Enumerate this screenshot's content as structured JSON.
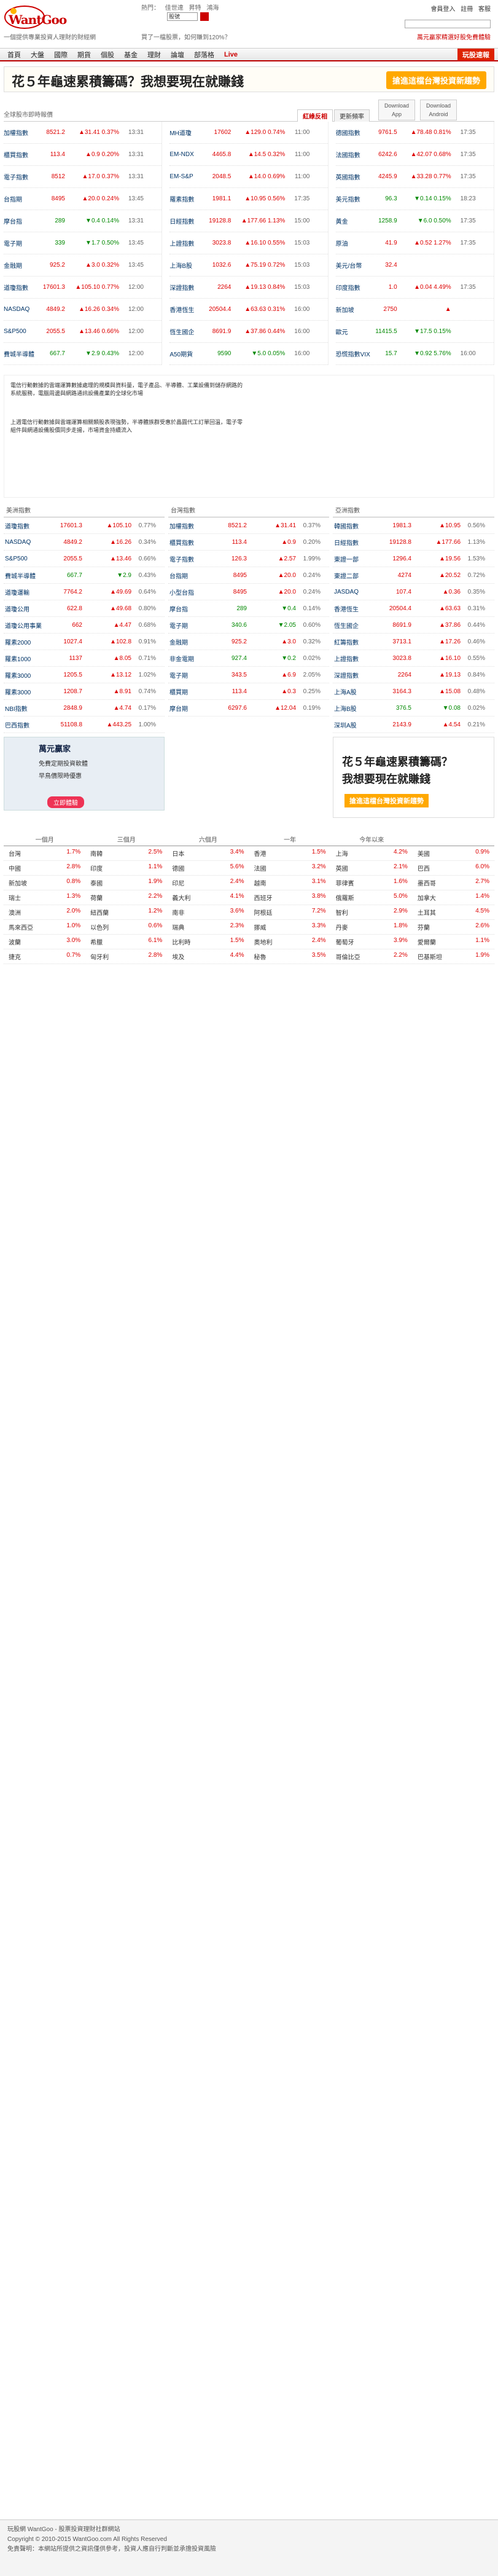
{
  "header": {
    "logo": "WantGoo",
    "hot_label": "熱門：",
    "hot_items": [
      "佳世達",
      "昇特",
      "鴻海"
    ],
    "search_placeholder": "股號",
    "top_links": [
      "會員登入",
      "註冊",
      "客服"
    ],
    "sub_left": "一個提供專業投資人理財的財經網",
    "sub_mid": "買了一檔股票，如何賺到120%？",
    "sub_right": "萬元贏家精選好股免費體驗"
  },
  "nav": {
    "items": [
      "首頁",
      "大盤",
      "國際",
      "期貨",
      "個股",
      "基金",
      "理財",
      "論壇",
      "部落格",
      "Live"
    ],
    "cta": "玩股速報"
  },
  "banner": {
    "text": "花５年龜速累積籌碼？我想要現在就賺錢",
    "button": "搶進這檔台灣投資新趨勢"
  },
  "quote_tabs": {
    "label": "全球股市即時報價",
    "tabs": [
      "紅綠反相",
      "更新頻率"
    ],
    "app_ios": "Download App",
    "app_android": "Download Android"
  },
  "quotes": [
    [
      {
        "name": "加權指數",
        "price": "8521.2",
        "chg": "▲31.41",
        "pct": "0.37%",
        "time": "13:31",
        "dir": "up"
      },
      {
        "name": "櫃買指數",
        "price": "113.4",
        "chg": "▲0.9",
        "pct": "0.20%",
        "time": "13:31",
        "dir": "up"
      },
      {
        "name": "電子指數",
        "price": "8512",
        "chg": "▲17.0",
        "pct": "0.37%",
        "time": "13:31",
        "dir": "up"
      },
      {
        "name": "台指期",
        "price": "8495",
        "chg": "▲20.0",
        "pct": "0.24%",
        "time": "13:45",
        "dir": "up"
      },
      {
        "name": "摩台指",
        "price": "289",
        "chg": "▼0.4",
        "pct": "0.14%",
        "time": "13:31",
        "dir": "down"
      },
      {
        "name": "電子期",
        "price": "339",
        "chg": "▼1.7",
        "pct": "0.50%",
        "time": "13:45",
        "dir": "down"
      },
      {
        "name": "金融期",
        "price": "925.2",
        "chg": "▲3.0",
        "pct": "0.32%",
        "time": "13:45",
        "dir": "up"
      },
      {
        "name": "道瓊指數",
        "price": "17601.3",
        "chg": "▲105.10",
        "pct": "0.77%",
        "time": "12:00",
        "dir": "up"
      },
      {
        "name": "NASDAQ",
        "price": "4849.2",
        "chg": "▲16.26",
        "pct": "0.34%",
        "time": "12:00",
        "dir": "up"
      },
      {
        "name": "S&P500",
        "price": "2055.5",
        "chg": "▲13.46",
        "pct": "0.66%",
        "time": "12:00",
        "dir": "up"
      },
      {
        "name": "費城半導體",
        "price": "667.7",
        "chg": "▼2.9",
        "pct": "0.43%",
        "time": "12:00",
        "dir": "down"
      }
    ],
    [
      {
        "name": "MH道瓊",
        "price": "17602",
        "chg": "▲129.0",
        "pct": "0.74%",
        "time": "11:00",
        "dir": "up"
      },
      {
        "name": "EM-NDX",
        "price": "4465.8",
        "chg": "▲14.5",
        "pct": "0.32%",
        "time": "11:00",
        "dir": "up"
      },
      {
        "name": "EM-S&P",
        "price": "2048.5",
        "chg": "▲14.0",
        "pct": "0.69%",
        "time": "11:00",
        "dir": "up"
      },
      {
        "name": "羅素指數",
        "price": "1981.1",
        "chg": "▲10.95",
        "pct": "0.56%",
        "time": "17:35",
        "dir": "up"
      },
      {
        "name": "日經指數",
        "price": "19128.8",
        "chg": "▲177.66",
        "pct": "1.13%",
        "time": "15:00",
        "dir": "up"
      },
      {
        "name": "上證指數",
        "price": "3023.8",
        "chg": "▲16.10",
        "pct": "0.55%",
        "time": "15:03",
        "dir": "up"
      },
      {
        "name": "上海B股",
        "price": "1032.6",
        "chg": "▲75.19",
        "pct": "0.72%",
        "time": "15:03",
        "dir": "up"
      },
      {
        "name": "深證指數",
        "price": "2264",
        "chg": "▲19.13",
        "pct": "0.84%",
        "time": "15:03",
        "dir": "up"
      },
      {
        "name": "香港恆生",
        "price": "20504.4",
        "chg": "▲63.63",
        "pct": "0.31%",
        "time": "16:00",
        "dir": "up"
      },
      {
        "name": "恆生國企",
        "price": "8691.9",
        "chg": "▲37.86",
        "pct": "0.44%",
        "time": "16:00",
        "dir": "up"
      },
      {
        "name": "A50期貨",
        "price": "9590",
        "chg": "▼5.0",
        "pct": "0.05%",
        "time": "16:00",
        "dir": "down"
      }
    ],
    [
      {
        "name": "德國指數",
        "price": "9761.5",
        "chg": "▲78.48",
        "pct": "0.81%",
        "time": "17:35",
        "dir": "up"
      },
      {
        "name": "法國指數",
        "price": "6242.6",
        "chg": "▲42.07",
        "pct": "0.68%",
        "time": "17:35",
        "dir": "up"
      },
      {
        "name": "英國指數",
        "price": "4245.9",
        "chg": "▲33.28",
        "pct": "0.77%",
        "time": "17:35",
        "dir": "up"
      },
      {
        "name": "美元指數",
        "price": "96.3",
        "chg": "▼0.14",
        "pct": "0.15%",
        "time": "18:23",
        "dir": "down"
      },
      {
        "name": "黃金",
        "price": "1258.9",
        "chg": "▼6.0",
        "pct": "0.50%",
        "time": "17:35",
        "dir": "down"
      },
      {
        "name": "原油",
        "price": "41.9",
        "chg": "▲0.52",
        "pct": "1.27%",
        "time": "17:35",
        "dir": "up"
      },
      {
        "name": "美元/台幣",
        "price": "32.4",
        "chg": "",
        "pct": "",
        "time": "",
        "dir": "up"
      },
      {
        "name": "印度指數",
        "price": "1.0",
        "chg": "▲0.04",
        "pct": "4.49%",
        "time": "17:35",
        "dir": "up"
      },
      {
        "name": "新加坡",
        "price": "2750",
        "chg": "▲",
        "pct": "",
        "time": "",
        "dir": "up"
      },
      {
        "name": "歐元",
        "price": "11415.5",
        "chg": "▼17.5",
        "pct": "0.15%",
        "time": "",
        "dir": "down"
      },
      {
        "name": "恐慌指數VIX",
        "price": "15.7",
        "chg": "▼0.92",
        "pct": "5.76%",
        "time": "16:00",
        "dir": "down"
      }
    ]
  ],
  "subsection": {
    "text1": "電信行動數據的雲端運算數據處理的規模與資料量，電子產品、半導體、工業設備到儲存網路的系統服務，電腦周邊與網路通訊設備產業的全球化市場",
    "text2": "上週電信行動數據與雲端運算相關類股表現強勢，半導體族群受惠於晶圓代工訂單回溫，電子零組件與網通設備股價同步走揚，市場資金持續流入"
  },
  "lower": {
    "col1_head": "美洲指數",
    "col2_head": "台灣指數",
    "col3_head": "亞洲指數",
    "col1": [
      {
        "name": "道瓊指數",
        "price": "17601.3",
        "chg": "▲105.10",
        "pct": "0.77%",
        "dir": "up"
      },
      {
        "name": "NASDAQ",
        "price": "4849.2",
        "chg": "▲16.26",
        "pct": "0.34%",
        "dir": "up"
      },
      {
        "name": "S&P500",
        "price": "2055.5",
        "chg": "▲13.46",
        "pct": "0.66%",
        "dir": "up"
      },
      {
        "name": "費城半導體",
        "price": "667.7",
        "chg": "▼2.9",
        "pct": "0.43%",
        "dir": "down"
      },
      {
        "name": "道瓊運輸",
        "price": "7764.2",
        "chg": "▲49.69",
        "pct": "0.64%",
        "dir": "up"
      },
      {
        "name": "道瓊公用",
        "price": "622.8",
        "chg": "▲49.68",
        "pct": "0.80%",
        "dir": "up"
      },
      {
        "name": "道瓊公用事業",
        "price": "662",
        "chg": "▲4.47",
        "pct": "0.68%",
        "dir": "up"
      },
      {
        "name": "羅素2000",
        "price": "1027.4",
        "chg": "▲102.8",
        "pct": "0.91%",
        "dir": "up"
      },
      {
        "name": "羅素1000",
        "price": "1137",
        "chg": "▲8.05",
        "pct": "0.71%",
        "dir": "up"
      },
      {
        "name": "羅素3000",
        "price": "1205.5",
        "chg": "▲13.12",
        "pct": "1.02%",
        "dir": "up"
      },
      {
        "name": "羅素3000",
        "price": "1208.7",
        "chg": "▲8.91",
        "pct": "0.74%",
        "dir": "up"
      },
      {
        "name": "NBI指數",
        "price": "2848.9",
        "chg": "▲4.74",
        "pct": "0.17%",
        "dir": "up"
      },
      {
        "name": "巴西指數",
        "price": "51108.8",
        "chg": "▲443.25",
        "pct": "1.00%",
        "dir": "up"
      }
    ],
    "col2": [
      {
        "name": "加權指數",
        "price": "8521.2",
        "chg": "▲31.41",
        "pct": "0.37%",
        "dir": "up"
      },
      {
        "name": "櫃買指數",
        "price": "113.4",
        "chg": "▲0.9",
        "pct": "0.20%",
        "dir": "up"
      },
      {
        "name": "電子指數",
        "price": "126.3",
        "chg": "▲2.57",
        "pct": "1.99%",
        "dir": "up"
      },
      {
        "name": "台指期",
        "price": "8495",
        "chg": "▲20.0",
        "pct": "0.24%",
        "dir": "up"
      },
      {
        "name": "小型台指",
        "price": "8495",
        "chg": "▲20.0",
        "pct": "0.24%",
        "dir": "up"
      },
      {
        "name": "摩台指",
        "price": "289",
        "chg": "▼0.4",
        "pct": "0.14%",
        "dir": "down"
      },
      {
        "name": "電子期",
        "price": "340.6",
        "chg": "▼2.05",
        "pct": "0.60%",
        "dir": "down"
      },
      {
        "name": "金融期",
        "price": "925.2",
        "chg": "▲3.0",
        "pct": "0.32%",
        "dir": "up"
      },
      {
        "name": "非金電期",
        "price": "927.4",
        "chg": "▼0.2",
        "pct": "0.02%",
        "dir": "down"
      },
      {
        "name": "電子期",
        "price": "343.5",
        "chg": "▲6.9",
        "pct": "2.05%",
        "dir": "up"
      },
      {
        "name": "櫃買期",
        "price": "113.4",
        "chg": "▲0.3",
        "pct": "0.25%",
        "dir": "up"
      },
      {
        "name": "摩台期",
        "price": "6297.6",
        "chg": "▲12.04",
        "pct": "0.19%",
        "dir": "up"
      }
    ],
    "col3": [
      {
        "name": "韓國指數",
        "price": "1981.3",
        "chg": "▲10.95",
        "pct": "0.56%",
        "dir": "up"
      },
      {
        "name": "日經指數",
        "price": "19128.8",
        "chg": "▲177.66",
        "pct": "1.13%",
        "dir": "up"
      },
      {
        "name": "東證一部",
        "price": "1296.4",
        "chg": "▲19.56",
        "pct": "1.53%",
        "dir": "up"
      },
      {
        "name": "東證二部",
        "price": "4274",
        "chg": "▲20.52",
        "pct": "0.72%",
        "dir": "up"
      },
      {
        "name": "JASDAQ",
        "price": "107.4",
        "chg": "▲0.36",
        "pct": "0.35%",
        "dir": "up"
      },
      {
        "name": "香港恆生",
        "price": "20504.4",
        "chg": "▲63.63",
        "pct": "0.31%",
        "dir": "up"
      },
      {
        "name": "恆生國企",
        "price": "8691.9",
        "chg": "▲37.86",
        "pct": "0.44%",
        "dir": "up"
      },
      {
        "name": "紅籌指數",
        "price": "3713.1",
        "chg": "▲17.26",
        "pct": "0.46%",
        "dir": "up"
      },
      {
        "name": "上證指數",
        "price": "3023.8",
        "chg": "▲16.10",
        "pct": "0.55%",
        "dir": "up"
      },
      {
        "name": "深證指數",
        "price": "2264",
        "chg": "▲19.13",
        "pct": "0.84%",
        "dir": "up"
      },
      {
        "name": "上海A股",
        "price": "3164.3",
        "chg": "▲15.08",
        "pct": "0.48%",
        "dir": "up"
      },
      {
        "name": "上海B股",
        "price": "376.5",
        "chg": "▼0.08",
        "pct": "0.02%",
        "dir": "down"
      },
      {
        "name": "深圳A股",
        "price": "2143.9",
        "chg": "▲4.54",
        "pct": "0.21%",
        "dir": "up"
      }
    ],
    "ad1": {
      "title": "萬元贏家",
      "line1": "免費定期投資軟體",
      "line2": "早鳥價限時優惠",
      "button": "立即體驗"
    },
    "ad2": {
      "line1": "花５年龜速累積籌碼？",
      "line2": "我想要現在就賺錢",
      "button": "搶進這檔台灣投資新趨勢"
    }
  },
  "perf": {
    "headers": [
      "一個月",
      "三個月",
      "六個月",
      "一年",
      "今年以來",
      ""
    ],
    "rows": [
      [
        "台灣",
        "1.7%",
        "南韓",
        "2.5%",
        "日本",
        "3.4%",
        "香港",
        "1.5%",
        "上海",
        "4.2%",
        "美國",
        "0.9%"
      ],
      [
        "中國",
        "2.8%",
        "印度",
        "1.1%",
        "德國",
        "5.6%",
        "法國",
        "3.2%",
        "英國",
        "2.1%",
        "巴西",
        "6.0%"
      ],
      [
        "新加坡",
        "0.8%",
        "泰國",
        "1.9%",
        "印尼",
        "2.4%",
        "越南",
        "3.1%",
        "菲律賓",
        "1.6%",
        "墨西哥",
        "2.7%"
      ],
      [
        "瑞士",
        "1.3%",
        "荷蘭",
        "2.2%",
        "義大利",
        "4.1%",
        "西班牙",
        "3.8%",
        "俄羅斯",
        "5.0%",
        "加拿大",
        "1.4%"
      ],
      [
        "澳洲",
        "2.0%",
        "紐西蘭",
        "1.2%",
        "南非",
        "3.6%",
        "阿根廷",
        "7.2%",
        "智利",
        "2.9%",
        "土耳其",
        "4.5%"
      ],
      [
        "馬來西亞",
        "1.0%",
        "以色列",
        "0.6%",
        "瑞典",
        "2.3%",
        "挪威",
        "3.3%",
        "丹麥",
        "1.8%",
        "芬蘭",
        "2.6%"
      ],
      [
        "波蘭",
        "3.0%",
        "希臘",
        "6.1%",
        "比利時",
        "1.5%",
        "奧地利",
        "2.4%",
        "葡萄牙",
        "3.9%",
        "愛爾蘭",
        "1.1%"
      ],
      [
        "捷克",
        "0.7%",
        "匈牙利",
        "2.8%",
        "埃及",
        "4.4%",
        "秘魯",
        "3.5%",
        "哥倫比亞",
        "2.2%",
        "巴基斯坦",
        "1.9%"
      ]
    ]
  },
  "footer": {
    "line1": "玩股網 WantGoo - 股票投資理財社群網站",
    "line2": "Copyright © 2010-2015 WantGoo.com All Rights Reserved",
    "line3": "免責聲明：本網站所提供之資訊僅供參考，投資人應自行判斷並承擔投資風險"
  },
  "colors": {
    "up": "#dd0000",
    "down": "#008800",
    "brand": "#cc0000",
    "cta": "#ffa800"
  }
}
